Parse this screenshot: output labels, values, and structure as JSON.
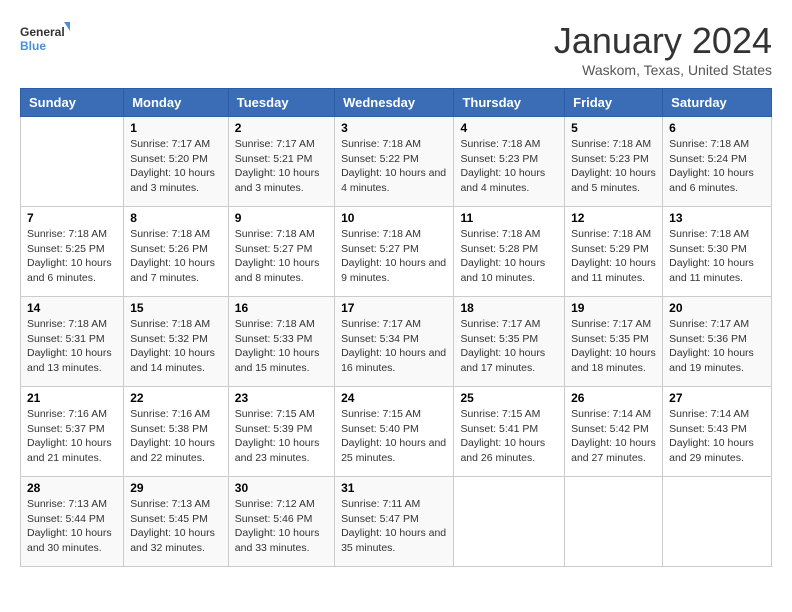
{
  "logo": {
    "text_general": "General",
    "text_blue": "Blue"
  },
  "title": "January 2024",
  "location": "Waskom, Texas, United States",
  "headers": [
    "Sunday",
    "Monday",
    "Tuesday",
    "Wednesday",
    "Thursday",
    "Friday",
    "Saturday"
  ],
  "weeks": [
    [
      {
        "day": "",
        "sunrise": "",
        "sunset": "",
        "daylight": ""
      },
      {
        "day": "1",
        "sunrise": "Sunrise: 7:17 AM",
        "sunset": "Sunset: 5:20 PM",
        "daylight": "Daylight: 10 hours and 3 minutes."
      },
      {
        "day": "2",
        "sunrise": "Sunrise: 7:17 AM",
        "sunset": "Sunset: 5:21 PM",
        "daylight": "Daylight: 10 hours and 3 minutes."
      },
      {
        "day": "3",
        "sunrise": "Sunrise: 7:18 AM",
        "sunset": "Sunset: 5:22 PM",
        "daylight": "Daylight: 10 hours and 4 minutes."
      },
      {
        "day": "4",
        "sunrise": "Sunrise: 7:18 AM",
        "sunset": "Sunset: 5:23 PM",
        "daylight": "Daylight: 10 hours and 4 minutes."
      },
      {
        "day": "5",
        "sunrise": "Sunrise: 7:18 AM",
        "sunset": "Sunset: 5:23 PM",
        "daylight": "Daylight: 10 hours and 5 minutes."
      },
      {
        "day": "6",
        "sunrise": "Sunrise: 7:18 AM",
        "sunset": "Sunset: 5:24 PM",
        "daylight": "Daylight: 10 hours and 6 minutes."
      }
    ],
    [
      {
        "day": "7",
        "sunrise": "Sunrise: 7:18 AM",
        "sunset": "Sunset: 5:25 PM",
        "daylight": "Daylight: 10 hours and 6 minutes."
      },
      {
        "day": "8",
        "sunrise": "Sunrise: 7:18 AM",
        "sunset": "Sunset: 5:26 PM",
        "daylight": "Daylight: 10 hours and 7 minutes."
      },
      {
        "day": "9",
        "sunrise": "Sunrise: 7:18 AM",
        "sunset": "Sunset: 5:27 PM",
        "daylight": "Daylight: 10 hours and 8 minutes."
      },
      {
        "day": "10",
        "sunrise": "Sunrise: 7:18 AM",
        "sunset": "Sunset: 5:27 PM",
        "daylight": "Daylight: 10 hours and 9 minutes."
      },
      {
        "day": "11",
        "sunrise": "Sunrise: 7:18 AM",
        "sunset": "Sunset: 5:28 PM",
        "daylight": "Daylight: 10 hours and 10 minutes."
      },
      {
        "day": "12",
        "sunrise": "Sunrise: 7:18 AM",
        "sunset": "Sunset: 5:29 PM",
        "daylight": "Daylight: 10 hours and 11 minutes."
      },
      {
        "day": "13",
        "sunrise": "Sunrise: 7:18 AM",
        "sunset": "Sunset: 5:30 PM",
        "daylight": "Daylight: 10 hours and 11 minutes."
      }
    ],
    [
      {
        "day": "14",
        "sunrise": "Sunrise: 7:18 AM",
        "sunset": "Sunset: 5:31 PM",
        "daylight": "Daylight: 10 hours and 13 minutes."
      },
      {
        "day": "15",
        "sunrise": "Sunrise: 7:18 AM",
        "sunset": "Sunset: 5:32 PM",
        "daylight": "Daylight: 10 hours and 14 minutes."
      },
      {
        "day": "16",
        "sunrise": "Sunrise: 7:18 AM",
        "sunset": "Sunset: 5:33 PM",
        "daylight": "Daylight: 10 hours and 15 minutes."
      },
      {
        "day": "17",
        "sunrise": "Sunrise: 7:17 AM",
        "sunset": "Sunset: 5:34 PM",
        "daylight": "Daylight: 10 hours and 16 minutes."
      },
      {
        "day": "18",
        "sunrise": "Sunrise: 7:17 AM",
        "sunset": "Sunset: 5:35 PM",
        "daylight": "Daylight: 10 hours and 17 minutes."
      },
      {
        "day": "19",
        "sunrise": "Sunrise: 7:17 AM",
        "sunset": "Sunset: 5:35 PM",
        "daylight": "Daylight: 10 hours and 18 minutes."
      },
      {
        "day": "20",
        "sunrise": "Sunrise: 7:17 AM",
        "sunset": "Sunset: 5:36 PM",
        "daylight": "Daylight: 10 hours and 19 minutes."
      }
    ],
    [
      {
        "day": "21",
        "sunrise": "Sunrise: 7:16 AM",
        "sunset": "Sunset: 5:37 PM",
        "daylight": "Daylight: 10 hours and 21 minutes."
      },
      {
        "day": "22",
        "sunrise": "Sunrise: 7:16 AM",
        "sunset": "Sunset: 5:38 PM",
        "daylight": "Daylight: 10 hours and 22 minutes."
      },
      {
        "day": "23",
        "sunrise": "Sunrise: 7:15 AM",
        "sunset": "Sunset: 5:39 PM",
        "daylight": "Daylight: 10 hours and 23 minutes."
      },
      {
        "day": "24",
        "sunrise": "Sunrise: 7:15 AM",
        "sunset": "Sunset: 5:40 PM",
        "daylight": "Daylight: 10 hours and 25 minutes."
      },
      {
        "day": "25",
        "sunrise": "Sunrise: 7:15 AM",
        "sunset": "Sunset: 5:41 PM",
        "daylight": "Daylight: 10 hours and 26 minutes."
      },
      {
        "day": "26",
        "sunrise": "Sunrise: 7:14 AM",
        "sunset": "Sunset: 5:42 PM",
        "daylight": "Daylight: 10 hours and 27 minutes."
      },
      {
        "day": "27",
        "sunrise": "Sunrise: 7:14 AM",
        "sunset": "Sunset: 5:43 PM",
        "daylight": "Daylight: 10 hours and 29 minutes."
      }
    ],
    [
      {
        "day": "28",
        "sunrise": "Sunrise: 7:13 AM",
        "sunset": "Sunset: 5:44 PM",
        "daylight": "Daylight: 10 hours and 30 minutes."
      },
      {
        "day": "29",
        "sunrise": "Sunrise: 7:13 AM",
        "sunset": "Sunset: 5:45 PM",
        "daylight": "Daylight: 10 hours and 32 minutes."
      },
      {
        "day": "30",
        "sunrise": "Sunrise: 7:12 AM",
        "sunset": "Sunset: 5:46 PM",
        "daylight": "Daylight: 10 hours and 33 minutes."
      },
      {
        "day": "31",
        "sunrise": "Sunrise: 7:11 AM",
        "sunset": "Sunset: 5:47 PM",
        "daylight": "Daylight: 10 hours and 35 minutes."
      },
      {
        "day": "",
        "sunrise": "",
        "sunset": "",
        "daylight": ""
      },
      {
        "day": "",
        "sunrise": "",
        "sunset": "",
        "daylight": ""
      },
      {
        "day": "",
        "sunrise": "",
        "sunset": "",
        "daylight": ""
      }
    ]
  ]
}
